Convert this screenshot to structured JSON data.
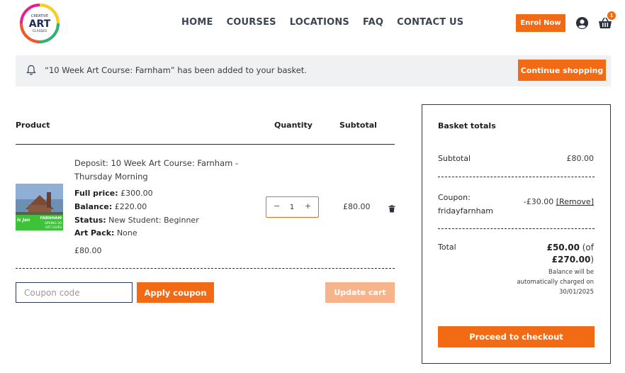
{
  "header": {
    "logo": {
      "word_top": "CREATIVE",
      "word_main": "ART",
      "word_bottom": "CLASSES"
    },
    "nav": [
      {
        "label": "HOME"
      },
      {
        "label": "COURSES"
      },
      {
        "label": "LOCATIONS"
      },
      {
        "label": "FAQ"
      },
      {
        "label": "CONTACT US"
      }
    ],
    "enrol_label": "Enrol Now",
    "basket_count": "1",
    "icons": {
      "account": "user-circle-icon",
      "basket": "basket-icon"
    }
  },
  "notice": {
    "icon": "bell-icon",
    "message": "“10 Week Art Course: Farnham” has been added to your basket.",
    "continue_label": "Continue shopping"
  },
  "cart": {
    "headers": {
      "product": "Product",
      "quantity": "Quantity",
      "subtotal": "Subtotal"
    },
    "items": [
      {
        "name": "Deposit: 10 Week Art Course: Farnham - Thursday Morning",
        "thumb_banner_line1": "FARNHAM",
        "thumb_banner_line2": "SPRING 20",
        "thumb_banner_line3": "ART COURS",
        "thumb_left_text": "ls Jan",
        "meta": [
          {
            "label": "Full price:",
            "value": "£300.00"
          },
          {
            "label": "Balance:",
            "value": "£220.00"
          },
          {
            "label": "Status:",
            "value": "New Student: Beginner"
          },
          {
            "label": "Art Pack:",
            "value": "None"
          }
        ],
        "price": "£80.00",
        "quantity": "1",
        "minus": "−",
        "plus": "+",
        "subtotal": "£80.00",
        "remove_icon": "trash-icon"
      }
    ],
    "coupon_placeholder": "Coupon code",
    "apply_label": "Apply coupon",
    "update_label": "Update cart"
  },
  "totals": {
    "title": "Basket totals",
    "subtotal_label": "Subtotal",
    "subtotal_value": "£80.00",
    "coupon_label": "Coupon: fridayfarnham",
    "coupon_value": "-£30.00",
    "coupon_remove": "[Remove]",
    "total_label": "Total",
    "total_value": "£50.00",
    "total_of_prefix": "(of",
    "total_full": "£270.00",
    "total_of_suffix": ")",
    "balance_note": "Balance will be automatically charged on 30/01/2025",
    "checkout_label": "Proceed to checkout"
  },
  "colors": {
    "accent": "#f26a13",
    "accent_disabled": "#f7b48a",
    "navy": "#2d3a55",
    "notice_bg": "#eff1f3"
  }
}
